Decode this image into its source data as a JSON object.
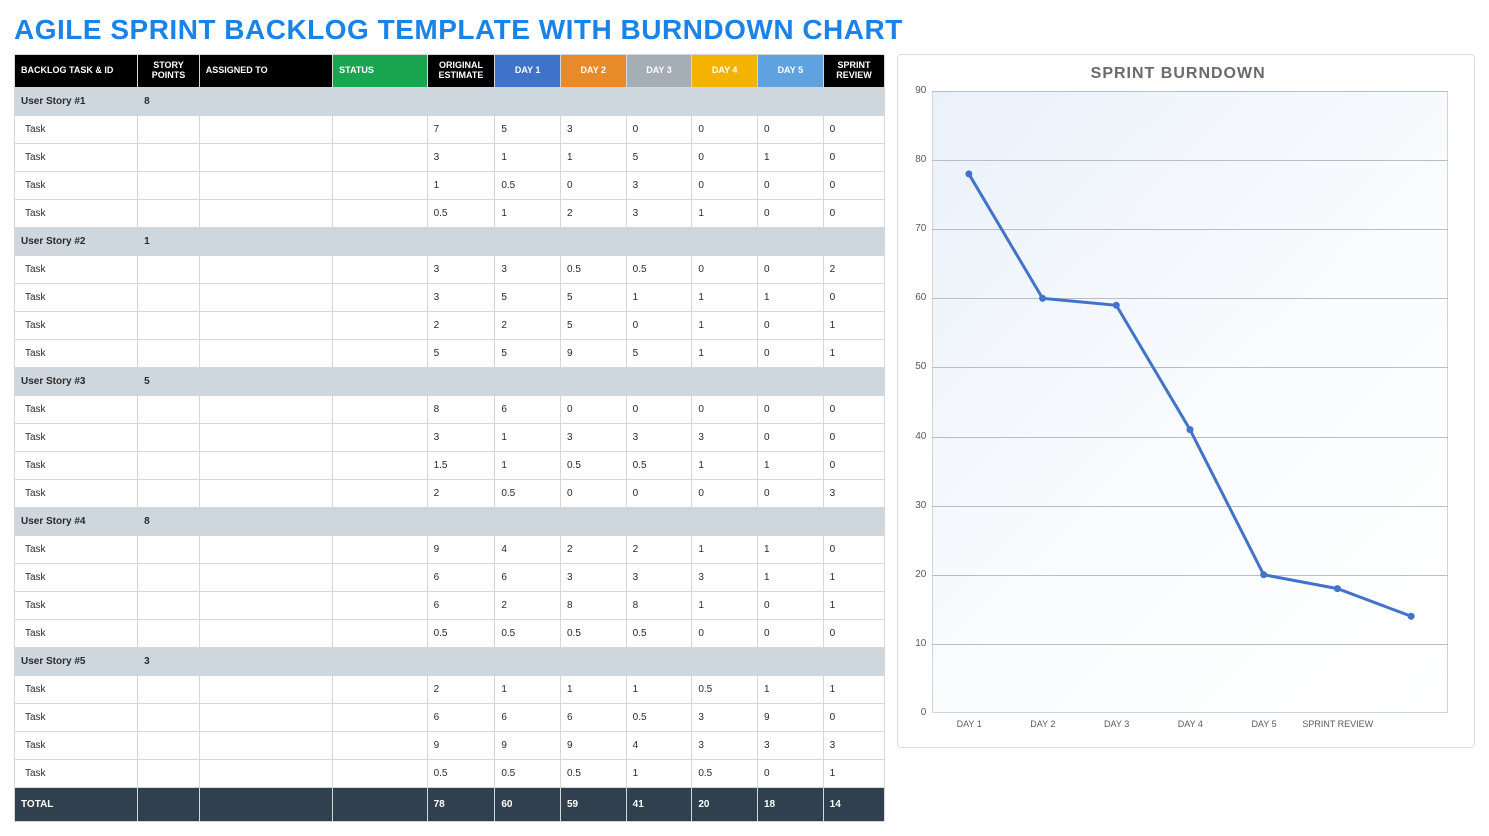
{
  "title": "AGILE SPRINT BACKLOG TEMPLATE WITH BURNDOWN CHART",
  "columns": {
    "task": "BACKLOG TASK & ID",
    "points": "STORY POINTS",
    "assigned": "ASSIGNED TO",
    "status": "STATUS",
    "estimate": "ORIGINAL ESTIMATE",
    "day1": "DAY 1",
    "day2": "DAY 2",
    "day3": "DAY 3",
    "day4": "DAY 4",
    "day5": "DAY 5",
    "review": "SPRINT REVIEW"
  },
  "groups": [
    {
      "story": {
        "name": "User Story #1",
        "points": "8"
      },
      "tasks": [
        {
          "name": "Task",
          "est": "7",
          "d1": "5",
          "d2": "3",
          "d3": "0",
          "d4": "0",
          "d5": "0",
          "rev": "0"
        },
        {
          "name": "Task",
          "est": "3",
          "d1": "1",
          "d2": "1",
          "d3": "5",
          "d4": "0",
          "d5": "1",
          "rev": "0"
        },
        {
          "name": "Task",
          "est": "1",
          "d1": "0.5",
          "d2": "0",
          "d3": "3",
          "d4": "0",
          "d5": "0",
          "rev": "0"
        },
        {
          "name": "Task",
          "est": "0.5",
          "d1": "1",
          "d2": "2",
          "d3": "3",
          "d4": "1",
          "d5": "0",
          "rev": "0"
        }
      ]
    },
    {
      "story": {
        "name": "User Story #2",
        "points": "1"
      },
      "tasks": [
        {
          "name": "Task",
          "est": "3",
          "d1": "3",
          "d2": "0.5",
          "d3": "0.5",
          "d4": "0",
          "d5": "0",
          "rev": "2"
        },
        {
          "name": "Task",
          "est": "3",
          "d1": "5",
          "d2": "5",
          "d3": "1",
          "d4": "1",
          "d5": "1",
          "rev": "0"
        },
        {
          "name": "Task",
          "est": "2",
          "d1": "2",
          "d2": "5",
          "d3": "0",
          "d4": "1",
          "d5": "0",
          "rev": "1"
        },
        {
          "name": "Task",
          "est": "5",
          "d1": "5",
          "d2": "9",
          "d3": "5",
          "d4": "1",
          "d5": "0",
          "rev": "1"
        }
      ]
    },
    {
      "story": {
        "name": "User Story #3",
        "points": "5"
      },
      "tasks": [
        {
          "name": "Task",
          "est": "8",
          "d1": "6",
          "d2": "0",
          "d3": "0",
          "d4": "0",
          "d5": "0",
          "rev": "0"
        },
        {
          "name": "Task",
          "est": "3",
          "d1": "1",
          "d2": "3",
          "d3": "3",
          "d4": "3",
          "d5": "0",
          "rev": "0"
        },
        {
          "name": "Task",
          "est": "1.5",
          "d1": "1",
          "d2": "0.5",
          "d3": "0.5",
          "d4": "1",
          "d5": "1",
          "rev": "0"
        },
        {
          "name": "Task",
          "est": "2",
          "d1": "0.5",
          "d2": "0",
          "d3": "0",
          "d4": "0",
          "d5": "0",
          "rev": "3"
        }
      ]
    },
    {
      "story": {
        "name": "User Story #4",
        "points": "8"
      },
      "tasks": [
        {
          "name": "Task",
          "est": "9",
          "d1": "4",
          "d2": "2",
          "d3": "2",
          "d4": "1",
          "d5": "1",
          "rev": "0"
        },
        {
          "name": "Task",
          "est": "6",
          "d1": "6",
          "d2": "3",
          "d3": "3",
          "d4": "3",
          "d5": "1",
          "rev": "1"
        },
        {
          "name": "Task",
          "est": "6",
          "d1": "2",
          "d2": "8",
          "d3": "8",
          "d4": "1",
          "d5": "0",
          "rev": "1"
        },
        {
          "name": "Task",
          "est": "0.5",
          "d1": "0.5",
          "d2": "0.5",
          "d3": "0.5",
          "d4": "0",
          "d5": "0",
          "rev": "0"
        }
      ]
    },
    {
      "story": {
        "name": "User Story #5",
        "points": "3"
      },
      "tasks": [
        {
          "name": "Task",
          "est": "2",
          "d1": "1",
          "d2": "1",
          "d3": "1",
          "d4": "0.5",
          "d5": "1",
          "rev": "1"
        },
        {
          "name": "Task",
          "est": "6",
          "d1": "6",
          "d2": "6",
          "d3": "0.5",
          "d4": "3",
          "d5": "9",
          "rev": "0"
        },
        {
          "name": "Task",
          "est": "9",
          "d1": "9",
          "d2": "9",
          "d3": "4",
          "d4": "3",
          "d5": "3",
          "rev": "3"
        },
        {
          "name": "Task",
          "est": "0.5",
          "d1": "0.5",
          "d2": "0.5",
          "d3": "1",
          "d4": "0.5",
          "d5": "0",
          "rev": "1"
        }
      ]
    }
  ],
  "totals": {
    "label": "TOTAL",
    "est": "78",
    "d1": "60",
    "d2": "59",
    "d3": "41",
    "d4": "20",
    "d5": "18",
    "rev": "14"
  },
  "chart_data": {
    "type": "line",
    "title": "SPRINT BURNDOWN",
    "ylabel": "",
    "xlabel": "",
    "ylim": [
      0,
      90
    ],
    "y_ticks": [
      0,
      10,
      20,
      30,
      40,
      50,
      60,
      70,
      80,
      90
    ],
    "categories": [
      "DAY 1",
      "DAY 2",
      "DAY 3",
      "DAY 4",
      "DAY 5",
      "SPRINT REVIEW"
    ],
    "values": [
      78,
      60,
      59,
      41,
      20,
      18,
      14
    ]
  }
}
